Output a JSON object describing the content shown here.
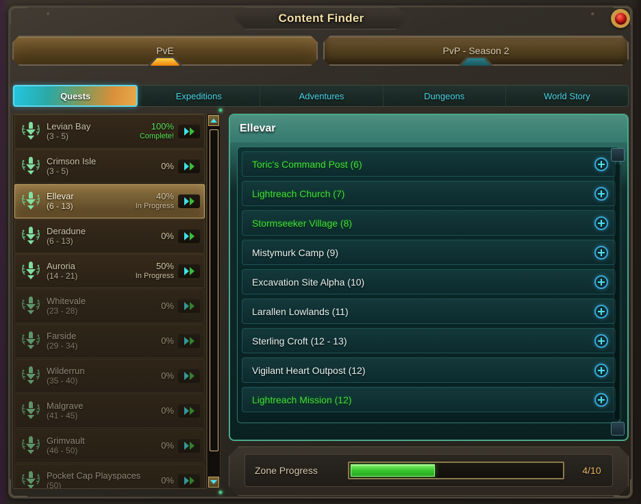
{
  "window": {
    "title": "Content Finder",
    "close_icon": "close-gem-icon"
  },
  "mode_tabs": [
    {
      "label": "PvE",
      "selected": true,
      "gem": "orange"
    },
    {
      "label": "PvP - Season 2",
      "selected": false,
      "gem": "teal"
    }
  ],
  "category_tabs": [
    {
      "label": "Quests",
      "active": true
    },
    {
      "label": "Expeditions",
      "active": false
    },
    {
      "label": "Adventures",
      "active": false
    },
    {
      "label": "Dungeons",
      "active": false
    },
    {
      "label": "World Story",
      "active": false
    }
  ],
  "zone_list": [
    {
      "name": "Levian Bay",
      "levels": "(3 - 5)",
      "percent": "100%",
      "status": "Complete!",
      "selected": false,
      "complete": true
    },
    {
      "name": "Crimson Isle",
      "levels": "(3 - 5)",
      "percent": "0%",
      "status": "",
      "selected": false,
      "complete": false
    },
    {
      "name": "Ellevar",
      "levels": "(6 - 13)",
      "percent": "40%",
      "status": "In Progress",
      "selected": true,
      "complete": false
    },
    {
      "name": "Deradune",
      "levels": "(6 - 13)",
      "percent": "0%",
      "status": "",
      "selected": false,
      "complete": false
    },
    {
      "name": "Auroria",
      "levels": "(14 - 21)",
      "percent": "50%",
      "status": "In Progress",
      "selected": false,
      "complete": false
    },
    {
      "name": "Whitevale",
      "levels": "(23 - 28)",
      "percent": "0%",
      "status": "",
      "selected": false,
      "complete": false
    },
    {
      "name": "Farside",
      "levels": "(29 - 34)",
      "percent": "0%",
      "status": "",
      "selected": false,
      "complete": false
    },
    {
      "name": "Wilderrun",
      "levels": "(35 - 40)",
      "percent": "0%",
      "status": "",
      "selected": false,
      "complete": false
    },
    {
      "name": "Malgrave",
      "levels": "(41 - 45)",
      "percent": "0%",
      "status": "",
      "selected": false,
      "complete": false
    },
    {
      "name": "Grimvault",
      "levels": "(46 - 50)",
      "percent": "0%",
      "status": "",
      "selected": false,
      "complete": false
    },
    {
      "name": "Pocket Cap Playspaces",
      "levels": "(50)",
      "percent": "0%",
      "status": "",
      "selected": false,
      "complete": false
    }
  ],
  "detail": {
    "header": "Ellevar",
    "quests": [
      {
        "label": "Toric's Command Post (6)",
        "complete": true
      },
      {
        "label": "Lightreach Church (7)",
        "complete": true
      },
      {
        "label": "Stormseeker Village (8)",
        "complete": true
      },
      {
        "label": "Mistymurk Camp (9)",
        "complete": false
      },
      {
        "label": "Excavation Site Alpha (10)",
        "complete": false
      },
      {
        "label": "Larallen Lowlands (11)",
        "complete": false
      },
      {
        "label": "Sterling Croft (12 - 13)",
        "complete": false
      },
      {
        "label": "Vigilant Heart Outpost (12)",
        "complete": false
      },
      {
        "label": "Lightreach Mission (12)",
        "complete": true
      }
    ]
  },
  "footer": {
    "label": "Zone Progress",
    "count": "4/10",
    "fill_percent": 40
  },
  "colors": {
    "accent_cyan": "#4fe0ea",
    "complete_green": "#41e03f",
    "gold_text": "#f3dfa8",
    "panel_teal": "#2d6a62",
    "progress_green": "#35c22c",
    "orange_gem": "#f08a10"
  }
}
